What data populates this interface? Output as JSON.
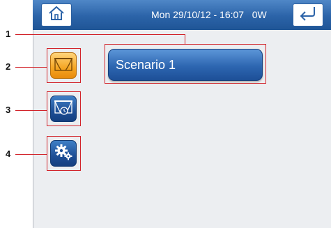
{
  "header": {
    "status_text": "Mon 29/10/12 - 16:07   0W",
    "home_icon": "home-icon",
    "back_icon": "return-arrow-icon"
  },
  "main": {
    "scenario_label": "Scenario 1",
    "buttons": [
      {
        "icon": "curtain-icon",
        "color": "#f5a623"
      },
      {
        "icon": "curtain-clock-icon",
        "color": "#1e4f96"
      },
      {
        "icon": "gears-icon",
        "color": "#1e4f96"
      }
    ]
  },
  "callouts": [
    "1",
    "2",
    "3",
    "4"
  ],
  "colors": {
    "accent_blue": "#2b63a8",
    "callout_red": "#d2232a",
    "active_orange": "#f5a623"
  }
}
